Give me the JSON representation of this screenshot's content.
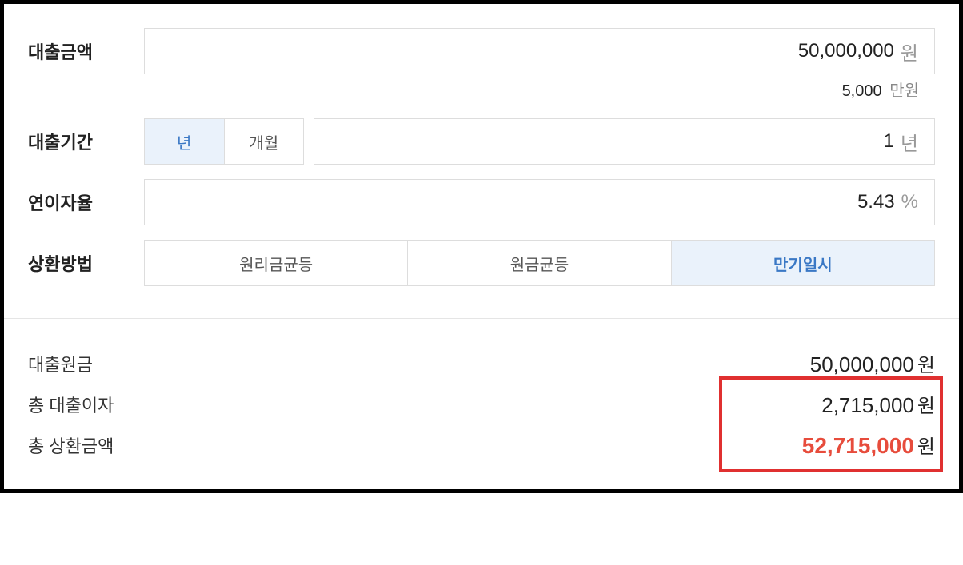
{
  "form": {
    "loanAmount": {
      "label": "대출금액",
      "value": "50,000,000",
      "unit": "원",
      "subValue": "5,000",
      "subUnit": "만원"
    },
    "loanTerm": {
      "label": "대출기간",
      "toggleYear": "년",
      "toggleMonth": "개월",
      "value": "1",
      "unit": "년"
    },
    "interestRate": {
      "label": "연이자율",
      "value": "5.43",
      "unit": "%"
    },
    "repayMethod": {
      "label": "상환방법",
      "option1": "원리금균등",
      "option2": "원금균등",
      "option3": "만기일시"
    }
  },
  "result": {
    "principal": {
      "label": "대출원금",
      "value": "50,000,000",
      "unit": "원"
    },
    "totalInterest": {
      "label": "총 대출이자",
      "value": "2,715,000",
      "unit": "원"
    },
    "totalRepayment": {
      "label": "총 상환금액",
      "value": "52,715,000",
      "unit": "원"
    }
  }
}
